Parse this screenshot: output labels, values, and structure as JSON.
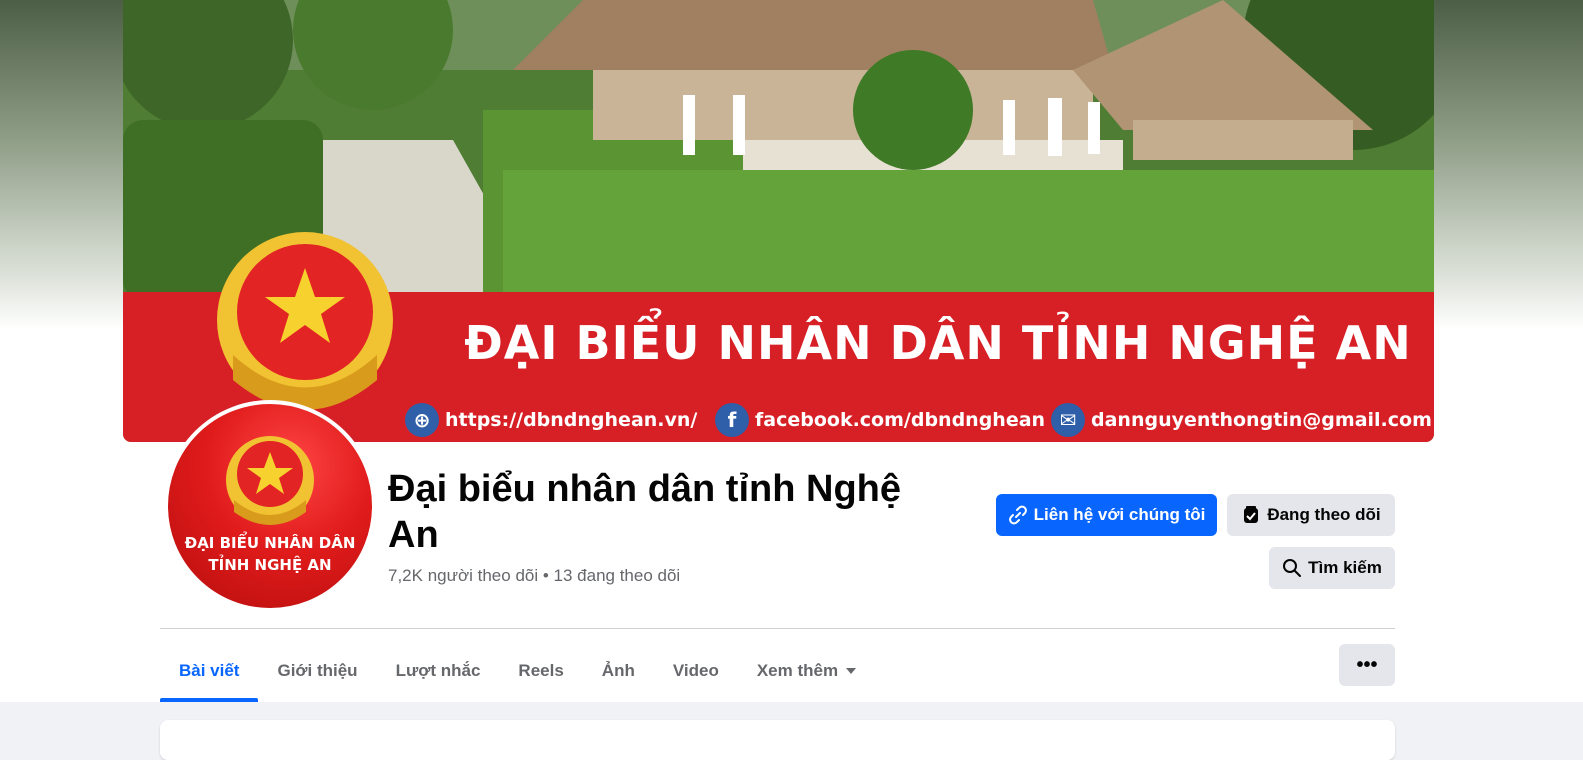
{
  "cover": {
    "banner_title": "ĐẠI BIỂU NHÂN DÂN TỈNH NGHỆ AN",
    "website": "https://dbndnghean.vn/",
    "facebook": "facebook.com/dbndnghean",
    "email": "dannguyenthongtin@gmail.com",
    "banner_color": "#d71f26"
  },
  "avatar": {
    "line1": "ĐẠI BIỂU NHÂN DÂN",
    "line2": "TỈNH NGHỆ AN"
  },
  "page": {
    "name": "Đại biểu nhân dân tỉnh Nghệ An",
    "stats": "7,2K người theo dõi • 13 đang theo dõi"
  },
  "actions": {
    "contact_label": "Liên hệ với chúng tôi",
    "following_label": "Đang theo dõi",
    "search_label": "Tìm kiếm",
    "more_label": "•••"
  },
  "tabs": [
    {
      "label": "Bài viết",
      "active": true
    },
    {
      "label": "Giới thiệu"
    },
    {
      "label": "Lượt nhắc"
    },
    {
      "label": "Reels"
    },
    {
      "label": "Ảnh"
    },
    {
      "label": "Video"
    },
    {
      "label": "Xem thêm"
    }
  ],
  "colors": {
    "accent": "#0866ff",
    "secondary_button": "#e4e6eb",
    "muted_text": "#65676b"
  }
}
